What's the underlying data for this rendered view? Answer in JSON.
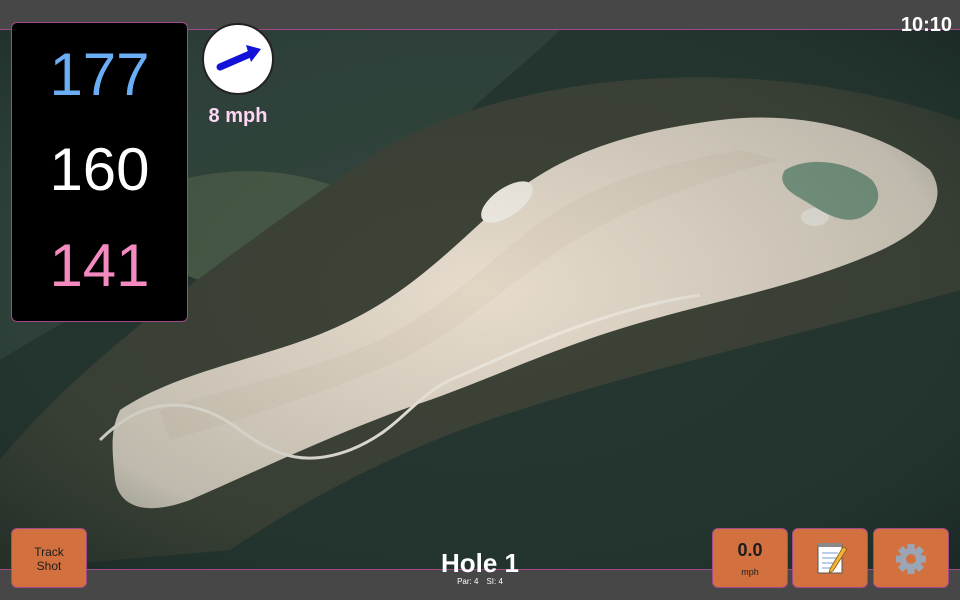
{
  "status_bar": {
    "time": "10:10"
  },
  "distances": {
    "back": "177",
    "middle": "160",
    "front": "141"
  },
  "wind": {
    "speed": "8 mph",
    "direction_icon": "arrow-right-up-icon"
  },
  "buttons": {
    "track_shot": "Track\nShot",
    "speed_value": "0.0",
    "speed_unit": "mph",
    "notes_icon": "notepad-icon",
    "settings_icon": "gear-icon"
  },
  "hole": {
    "title": "Hole 1",
    "par": "Par: 4",
    "si": "SI: 4"
  },
  "colors": {
    "accent_border": "#a04a8a",
    "button_orange": "#d2713f",
    "back_distance": "#6aaef5",
    "middle_distance": "#ffffff",
    "front_distance": "#f58ac0",
    "wind_text": "#ffd6f4"
  }
}
